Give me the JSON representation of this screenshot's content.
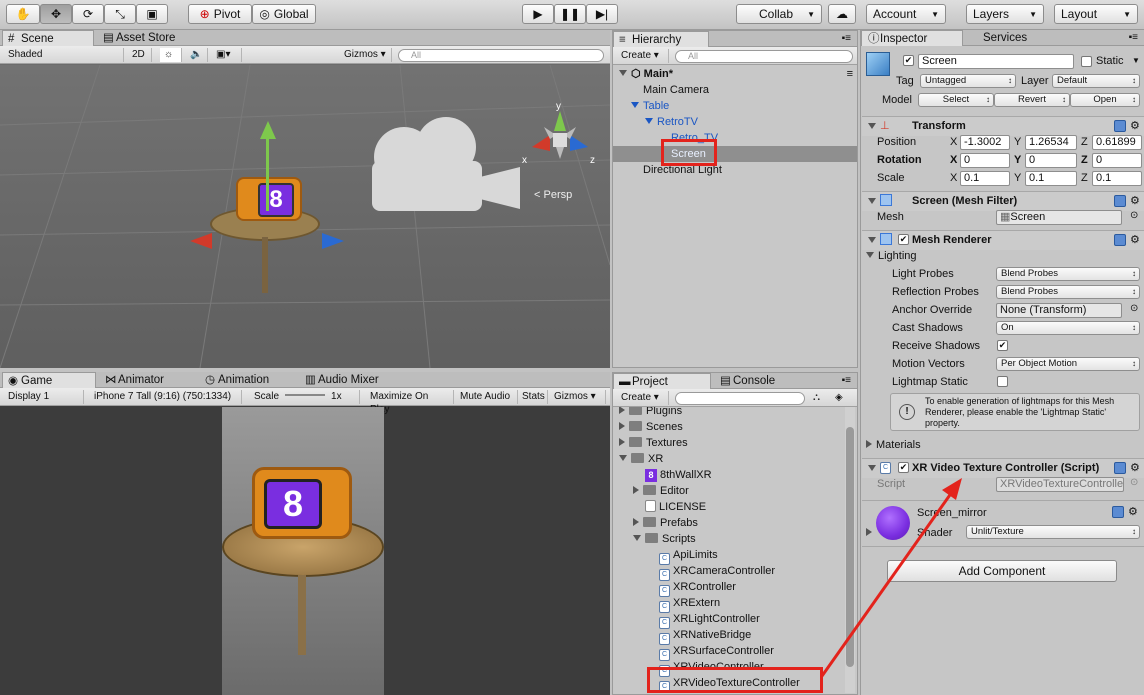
{
  "toolbar": {
    "pivot": "Pivot",
    "global": "Global",
    "collab": "Collab",
    "account": "Account",
    "layers": "Layers",
    "layout": "Layout"
  },
  "scene": {
    "tab": "Scene",
    "tab2": "Asset Store",
    "shading": "Shaded",
    "mode2d": "2D",
    "gizmos": "Gizmos",
    "search": "All",
    "persp": "Persp",
    "axis_x": "x",
    "axis_y": "y",
    "axis_z": "z"
  },
  "hierarchy": {
    "tab": "Hierarchy",
    "create": "Create",
    "search": "All",
    "scene": "Main*",
    "items": [
      "Main Camera",
      "Table",
      "RetroTV",
      "Retro_TV",
      "Screen",
      "Directional Light"
    ]
  },
  "game": {
    "tab": "Game",
    "tab2": "Animator",
    "tab3": "Animation",
    "tab4": "Audio Mixer",
    "display": "Display 1",
    "aspect": "iPhone 7 Tall (9:16) (750:1334)",
    "scale_label": "Scale",
    "scale_value": "1x",
    "maximize": "Maximize On Play",
    "mute": "Mute Audio",
    "stats": "Stats",
    "gizmos": "Gizmos"
  },
  "project": {
    "tab": "Project",
    "tab2": "Console",
    "create": "Create",
    "items": [
      "Plugins",
      "Scenes",
      "Textures",
      "XR",
      "8thWallXR",
      "Editor",
      "LICENSE",
      "Prefabs",
      "Scripts",
      "ApiLimits",
      "XRCameraController",
      "XRController",
      "XRExtern",
      "XRLightController",
      "XRNativeBridge",
      "XRSurfaceController",
      "XRVideoController",
      "XRVideoTextureController"
    ]
  },
  "inspector": {
    "tab": "Inspector",
    "tab2": "Services",
    "name": "Screen",
    "static": "Static",
    "tag_label": "Tag",
    "tag": "Untagged",
    "layer_label": "Layer",
    "layer": "Default",
    "model_label": "Model",
    "select": "Select",
    "revert": "Revert",
    "open": "Open",
    "transform": {
      "title": "Transform",
      "position": "Position",
      "rotation": "Rotation",
      "scale": "Scale",
      "pos": [
        "-1.3002",
        "1.26534",
        "0.61899"
      ],
      "rot": [
        "0",
        "0",
        "0"
      ],
      "scl": [
        "0.1",
        "0.1",
        "0.1"
      ],
      "x": "X",
      "y": "Y",
      "z": "Z"
    },
    "meshfilter": {
      "title": "Screen (Mesh Filter)",
      "mesh_label": "Mesh",
      "mesh": "Screen"
    },
    "renderer": {
      "title": "Mesh Renderer",
      "lighting": "Lighting",
      "light_probes": "Light Probes",
      "light_probes_v": "Blend Probes",
      "refl_probes": "Reflection Probes",
      "refl_probes_v": "Blend Probes",
      "anchor": "Anchor Override",
      "anchor_v": "None (Transform)",
      "cast": "Cast Shadows",
      "cast_v": "On",
      "receive": "Receive Shadows",
      "motion": "Motion Vectors",
      "motion_v": "Per Object Motion",
      "lightmap": "Lightmap Static",
      "info": "To enable generation of lightmaps for this Mesh Renderer, please enable the 'Lightmap Static' property.",
      "materials": "Materials"
    },
    "script": {
      "title": "XR Video Texture Controller (Script)",
      "label": "Script",
      "value": "XRVideoTextureController"
    },
    "material": {
      "name": "Screen_mirror",
      "shader_label": "Shader",
      "shader": "Unlit/Texture"
    },
    "add": "Add Component"
  },
  "colors": {
    "accent": "#3b78d8",
    "highlight": "#e3231c",
    "purple": "#7a2ee0"
  }
}
